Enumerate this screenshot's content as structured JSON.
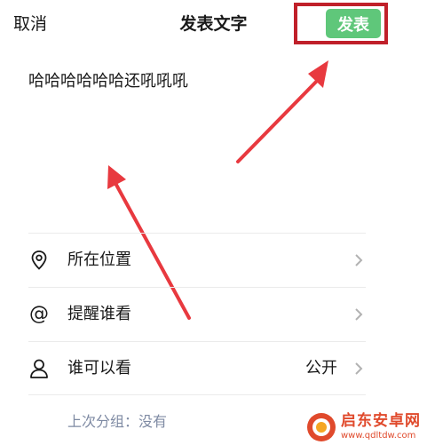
{
  "header": {
    "cancel_label": "取消",
    "title": "发表文字",
    "publish_label": "发表"
  },
  "post": {
    "text": "哈哈哈哈哈哈还吼吼吼"
  },
  "options": [
    {
      "label": "所在位置",
      "value": "",
      "icon": "location-pin-icon"
    },
    {
      "label": "提醒谁看",
      "value": "",
      "icon": "at-sign-icon"
    },
    {
      "label": "谁可以看",
      "value": "公开",
      "icon": "person-icon"
    }
  ],
  "last_group": {
    "text": "上次分组：没有"
  },
  "watermark": {
    "name": "启东安卓网",
    "url": "www.qdltdw.com"
  },
  "colors": {
    "publish_button": "#5fc77a",
    "highlight_box": "#c0202a",
    "arrow": "#e8393f",
    "secondary_text": "#7e8aa3",
    "watermark": "#e04a2c"
  }
}
